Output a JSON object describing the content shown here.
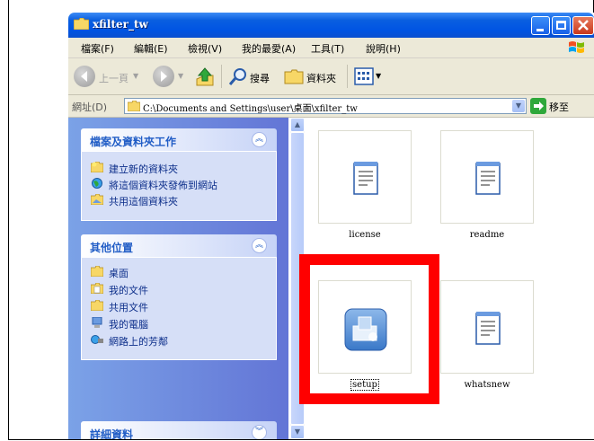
{
  "window": {
    "title": "xfilter_tw"
  },
  "menu": {
    "items": [
      "檔案(F)",
      "編輯(E)",
      "檢視(V)",
      "我的最愛(A)",
      "工具(T)",
      "說明(H)"
    ]
  },
  "toolbar": {
    "back": "上一頁",
    "search": "搜尋",
    "folders": "資料夾"
  },
  "address": {
    "label": "網址(D)",
    "path": "C:\\Documents and Settings\\user\\桌面\\xfilter_tw",
    "go": "移至"
  },
  "panels": [
    {
      "title": "檔案及資料夾工作",
      "items": [
        "建立新的資料夾",
        "將這個資料夾發佈到網站",
        "共用這個資料夾"
      ]
    },
    {
      "title": "其他位置",
      "items": [
        "桌面",
        "我的文件",
        "共用文件",
        "我的電腦",
        "網路上的芳鄰"
      ]
    },
    {
      "title": "詳細資料",
      "items": []
    }
  ],
  "files": [
    {
      "name": "license",
      "icon": "notepad-document-icon"
    },
    {
      "name": "readme",
      "icon": "notepad-document-icon"
    },
    {
      "name": "setup",
      "icon": "setup-installer-icon",
      "selected": true
    },
    {
      "name": "whatsnew",
      "icon": "notepad-document-icon"
    }
  ],
  "highlight": {
    "color": "#ff0000",
    "target": "setup"
  }
}
